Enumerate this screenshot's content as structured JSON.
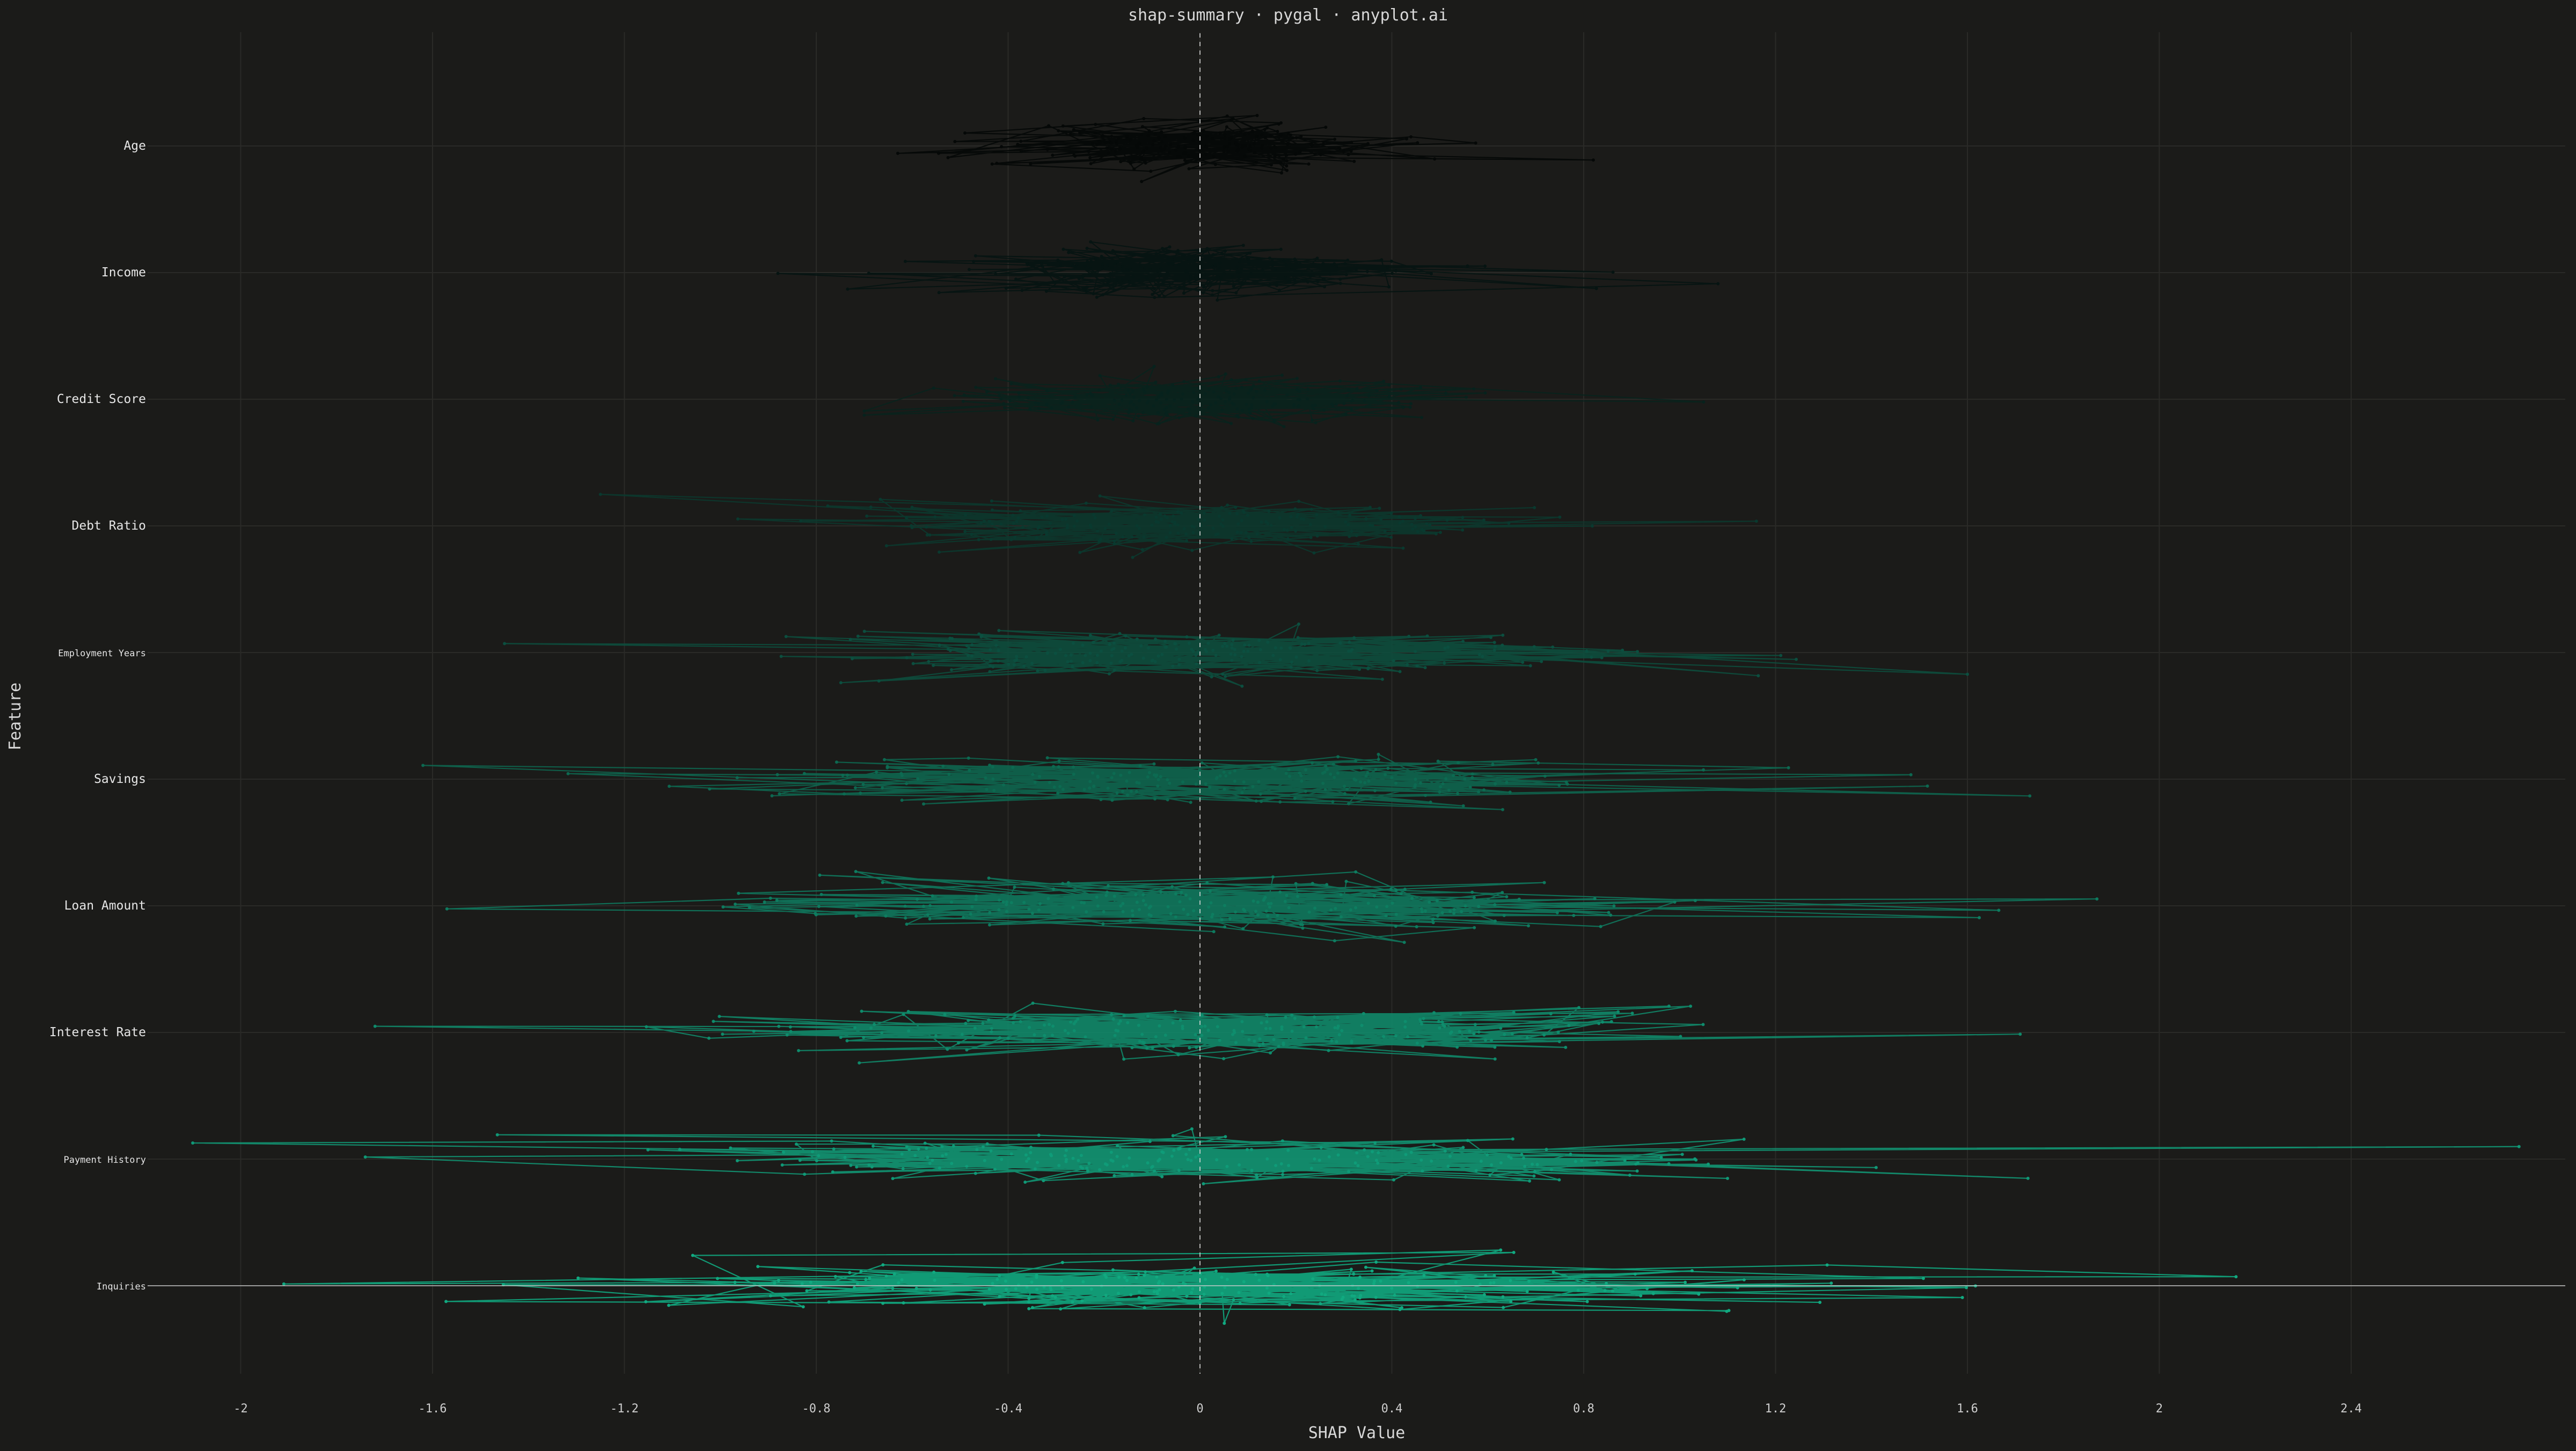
{
  "chart_data": {
    "type": "line",
    "title": "shap-summary · pygal · anyplot.ai",
    "xlabel": "SHAP Value",
    "ylabel": "Feature",
    "xlim": [
      -2.2,
      2.85
    ],
    "x_ticks": [
      "-2",
      "-1.6",
      "-1.2",
      "-0.8",
      "-0.4",
      "0",
      "0.4",
      "0.8",
      "1.2",
      "1.6",
      "2",
      "2.4"
    ],
    "x_tick_values": [
      -2,
      -1.6,
      -1.2,
      -0.8,
      -0.4,
      0,
      0.4,
      0.8,
      1.2,
      1.6,
      2,
      2.4
    ],
    "grid": true,
    "legend": "none",
    "reference_line": 0,
    "points_per_feature": 200,
    "colors": {
      "background": "#1b1b19",
      "low": "#000000",
      "high": "#0ea57e"
    },
    "series": [
      {
        "name": "Age",
        "range": [
          -0.63,
          0.82
        ],
        "spread": 0.22,
        "color": "#050807",
        "alpha": 0.95
      },
      {
        "name": "Income",
        "range": [
          -0.88,
          1.08
        ],
        "spread": 0.26,
        "color": "#061412",
        "alpha": 0.9
      },
      {
        "name": "Credit Score",
        "range": [
          -0.7,
          1.05
        ],
        "spread": 0.22,
        "color": "#07231d",
        "alpha": 0.85
      },
      {
        "name": "Debt Ratio",
        "range": [
          -1.25,
          1.16
        ],
        "spread": 0.33,
        "color": "#0a3a2f",
        "alpha": 0.85
      },
      {
        "name": "Employment Years",
        "range": [
          -1.45,
          1.6
        ],
        "spread": 0.42,
        "color": "#0c5040",
        "alpha": 0.85
      },
      {
        "name": "Savings",
        "range": [
          -1.62,
          1.73
        ],
        "spread": 0.45,
        "color": "#0d6a52",
        "alpha": 0.85
      },
      {
        "name": "Loan Amount",
        "range": [
          -1.57,
          1.87
        ],
        "spread": 0.46,
        "color": "#0e7d61",
        "alpha": 0.85
      },
      {
        "name": "Interest Rate",
        "range": [
          -1.72,
          1.71
        ],
        "spread": 0.5,
        "color": "#0f8e6e",
        "alpha": 0.85
      },
      {
        "name": "Payment History",
        "range": [
          -2.1,
          2.75
        ],
        "spread": 0.55,
        "color": "#109c79",
        "alpha": 0.85
      },
      {
        "name": "Inquiries",
        "range": [
          -1.91,
          2.16
        ],
        "spread": 0.6,
        "color": "#11a980",
        "alpha": 0.9
      }
    ]
  }
}
